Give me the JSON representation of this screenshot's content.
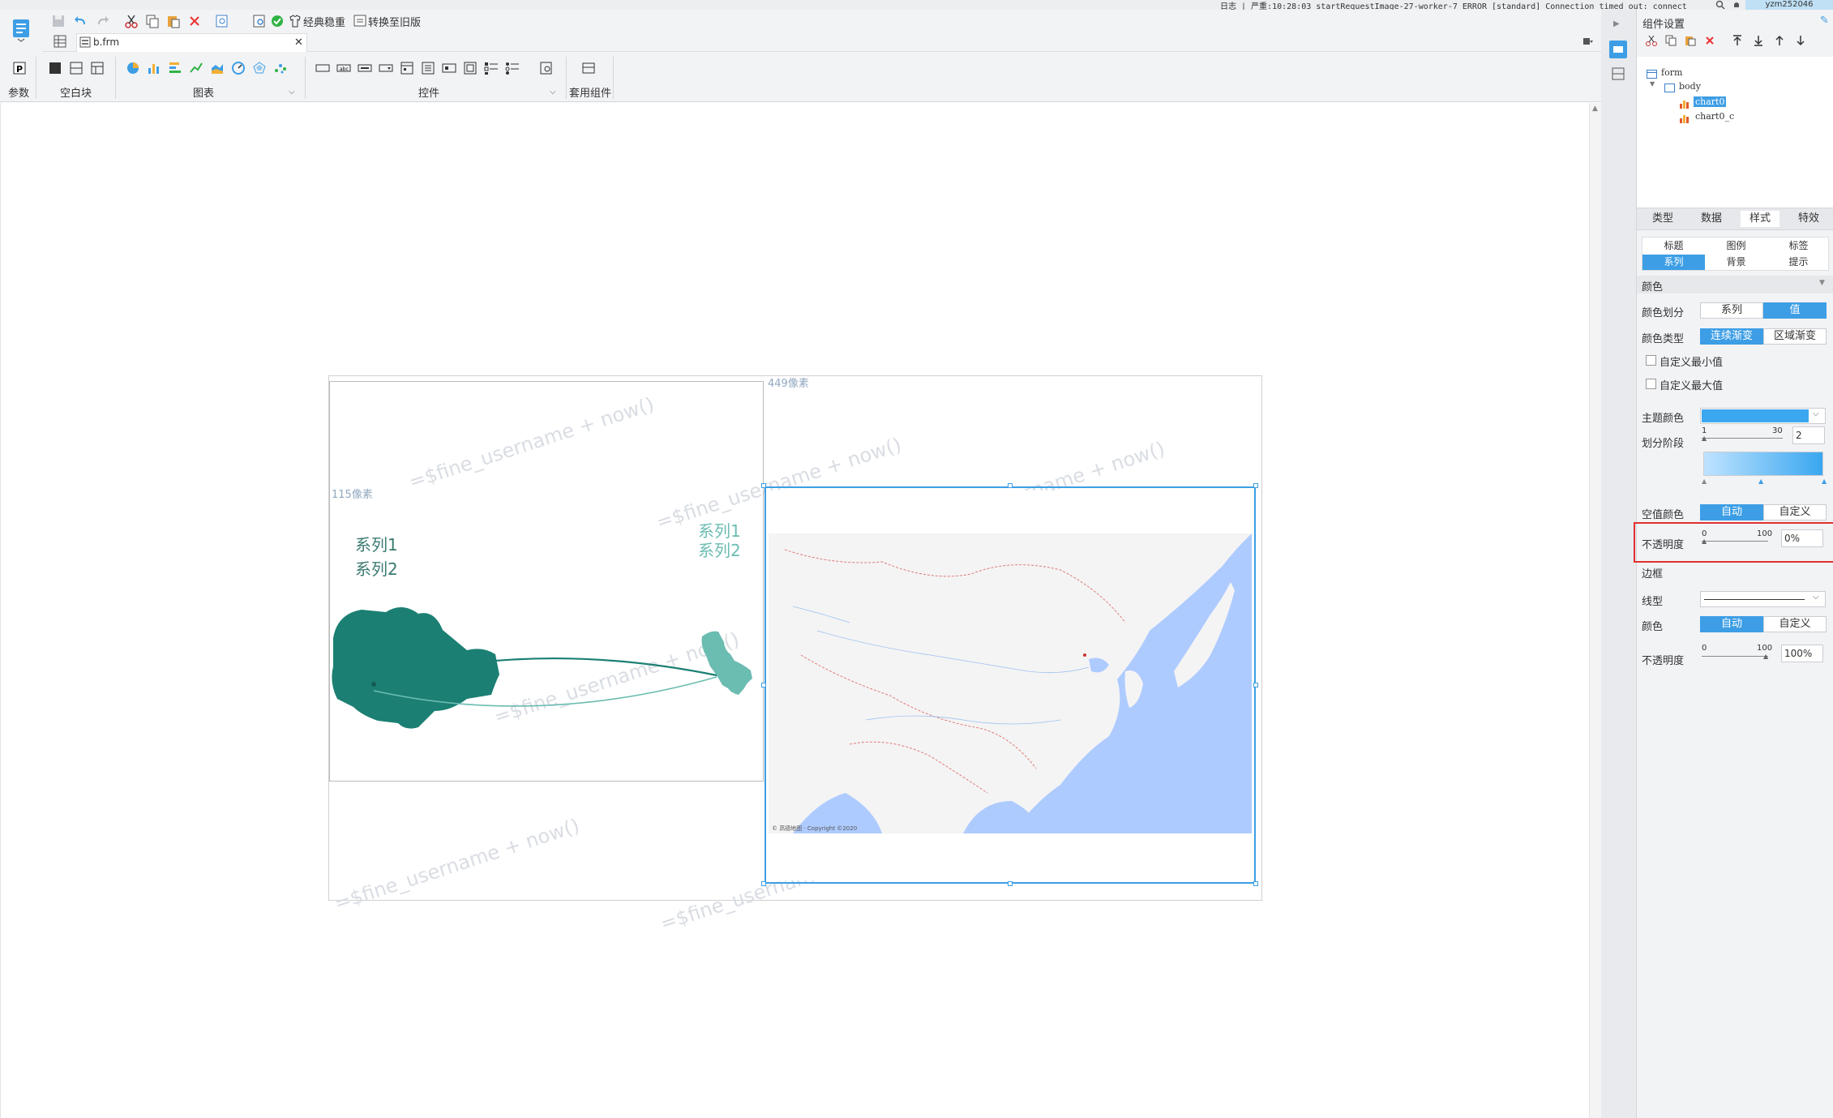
{
  "status_bar": {
    "text": "日志 | 严重:10:28:03 startRequestImage-27-worker-7 ERROR [standard] Connection timed out: connect",
    "user": "yzm252046"
  },
  "quick_toolbar": {
    "template_style": "经典稳重",
    "convert_old": "转换至旧版"
  },
  "file_tab": {
    "name": "b.frm"
  },
  "ribbon": {
    "groups": {
      "params": "参数",
      "blank": "空白块",
      "charts": "图表",
      "widgets": "控件",
      "suite": "套用组件"
    }
  },
  "canvas": {
    "dim_width": "449像素",
    "dim_height": "115像素",
    "watermark": "=$fine_username + now()",
    "legend": [
      "系列1",
      "系列2"
    ],
    "map_attribution": "© 高德地图 · Copyright ©2020"
  },
  "panel": {
    "title": "组件设置",
    "tree": {
      "root": "form",
      "body": "body",
      "children": [
        "chart0",
        "chart0_c"
      ]
    },
    "main_tabs": [
      "类型",
      "数据",
      "样式",
      "特效"
    ],
    "active_main_tab": "样式",
    "sub_tabs_row1": [
      "标题",
      "图例",
      "标签"
    ],
    "sub_tabs_row2": [
      "系列",
      "背景",
      "提示"
    ],
    "active_sub_tab": "系列",
    "section_color": "颜色",
    "color_split_label": "颜色划分",
    "color_split_options": [
      "系列",
      "值"
    ],
    "color_split_selected": "值",
    "color_type_label": "颜色类型",
    "color_type_options": [
      "连续渐变",
      "区域渐变"
    ],
    "color_type_selected": "连续渐变",
    "custom_min": "自定义最小值",
    "custom_max": "自定义最大值",
    "theme_color_label": "主题颜色",
    "theme_color": "#3aa7f0",
    "segments_label": "划分阶段",
    "segments_min": "1",
    "segments_max": "30",
    "segments_value": "2",
    "null_color_label": "空值颜色",
    "null_color_options": [
      "自动",
      "自定义"
    ],
    "null_color_selected": "自动",
    "opacity_label": "不透明度",
    "opacity_min": "0",
    "opacity_max": "100",
    "opacity_value": "0%",
    "section_border": "边框",
    "line_type_label": "线型",
    "border_color_label": "颜色",
    "border_color_options": [
      "自动",
      "自定义"
    ],
    "border_color_selected": "自动",
    "border_opacity_label": "不透明度",
    "border_opacity_min": "0",
    "border_opacity_max": "100",
    "border_opacity_value": "100%"
  },
  "colors": {
    "accent": "#3d9ee5",
    "teal_dark": "#1b7f73",
    "teal_light": "#6bbcb1",
    "highlight_box": "#e03030"
  }
}
